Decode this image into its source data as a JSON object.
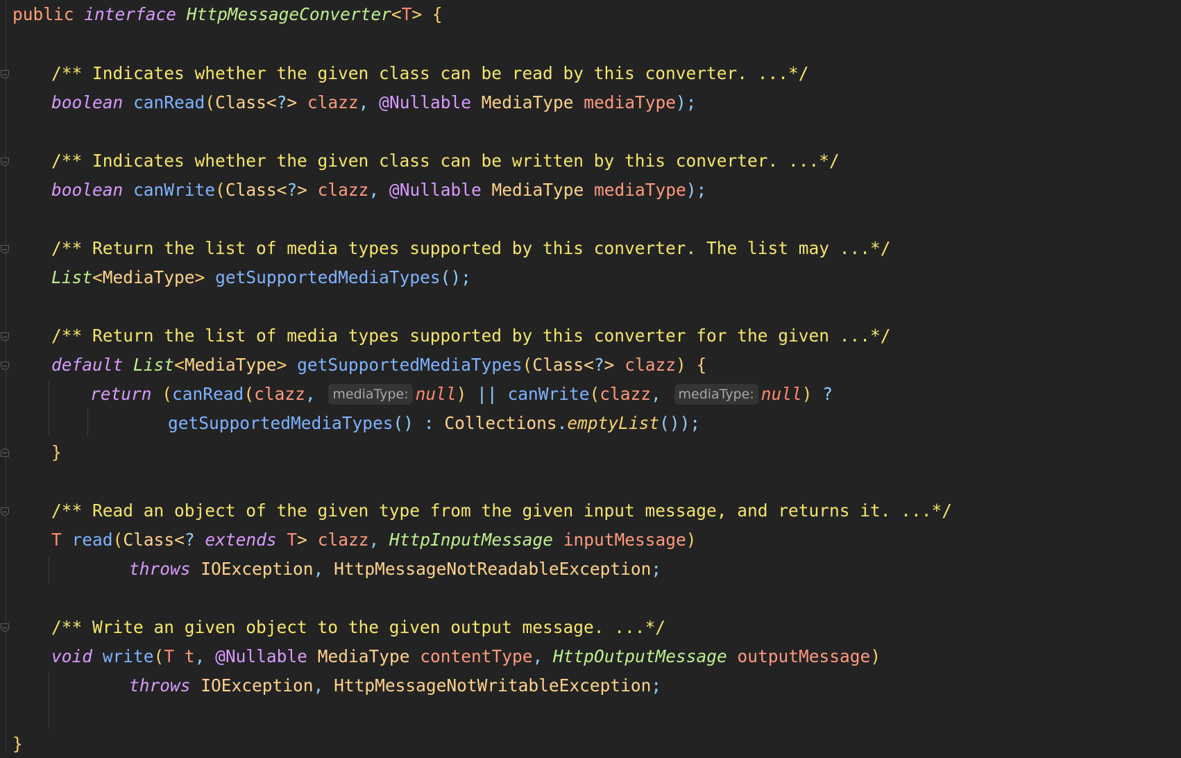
{
  "code": {
    "l1": {
      "public": "public",
      "interface": "interface",
      "name": "HttpMessageConverter",
      "lt": "<",
      "T": "T",
      "gt": ">",
      "brace": " {"
    },
    "l3": {
      "comment": "/** Indicates whether the given class can be read by this converter. ...*/"
    },
    "l4": {
      "ret": "boolean",
      "fn": "canRead",
      "p1": "(",
      "cls": "Class<",
      "q": "?",
      "gt": ">",
      "arg": "clazz",
      "comma": ",",
      "ann": "@",
      "annName": "Nullable",
      "type": "MediaType",
      "arg2": "mediaType",
      "end": ");"
    },
    "l6": {
      "comment": "/** Indicates whether the given class can be written by this converter. ...*/"
    },
    "l7": {
      "ret": "boolean",
      "fn": "canWrite",
      "p1": "(",
      "cls": "Class<",
      "q": "?",
      "gt": ">",
      "arg": "clazz",
      "comma": ",",
      "ann": "@",
      "annName": "Nullable",
      "type": "MediaType",
      "arg2": "mediaType",
      "end": ");"
    },
    "l9": {
      "comment": "/** Return the list of media types supported by this converter. The list may ...*/"
    },
    "l10": {
      "list": "List",
      "lt": "<",
      "type": "MediaType",
      "gt": ">",
      "fn": "getSupportedMediaTypes",
      "end": "();"
    },
    "l12": {
      "comment": "/** Return the list of media types supported by this converter for the given ...*/"
    },
    "l13": {
      "default": "default",
      "list": "List",
      "lt": "<",
      "type": "MediaType",
      "gt": ">",
      "fn": "getSupportedMediaTypes",
      "p1": "(",
      "cls": "Class<",
      "q": "?",
      "gt2": ">",
      "arg": "clazz",
      "end": ") {"
    },
    "l14": {
      "ret": "return",
      "p": "(",
      "fn1": "canRead",
      "p2": "(",
      "arg": "clazz",
      "comma": ",",
      "hint1": "mediaType:",
      "nul1": "null",
      "close": ")",
      "or": "||",
      "fn2": "canWrite",
      "p3": "(",
      "arg2": "clazz",
      "comma2": ",",
      "hint2": "mediaType:",
      "nul2": "null",
      "close2": ")",
      "q": "?"
    },
    "l15": {
      "fn": "getSupportedMediaTypes",
      "p": "()",
      "colon": ":",
      "cls": "Collections",
      "dot": ".",
      "stat": "emptyList",
      "end": "());"
    },
    "l16": {
      "brace": "}"
    },
    "l18": {
      "comment": "/** Read an object of the given type from the given input message, and returns it. ...*/"
    },
    "l19": {
      "T": "T",
      "fn": "read",
      "p1": "(",
      "cls": "Class<",
      "q": "?",
      "ext": "extends",
      "T2": "T",
      "gt": ">",
      "arg": "clazz",
      "comma": ",",
      "iface": "HttpInputMessage",
      "arg2": "inputMessage",
      "end": ")"
    },
    "l20": {
      "throws": "throws",
      "ex1": "IOException",
      "comma": ",",
      "ex2": "HttpMessageNotReadableException",
      "end": ";"
    },
    "l22": {
      "comment": "/** Write an given object to the given output message. ...*/"
    },
    "l23": {
      "ret": "void",
      "fn": "write",
      "p1": "(",
      "T": "T",
      "t": "t",
      "comma": ",",
      "ann": "@",
      "annName": "Nullable",
      "type": "MediaType",
      "arg": "contentType",
      "comma2": ",",
      "iface": "HttpOutputMessage",
      "arg2": "outputMessage",
      "end": ")"
    },
    "l24": {
      "throws": "throws",
      "ex1": "IOException",
      "comma": ",",
      "ex2": "HttpMessageNotWritableException",
      "end": ";"
    },
    "l26": {
      "brace": "}"
    }
  }
}
